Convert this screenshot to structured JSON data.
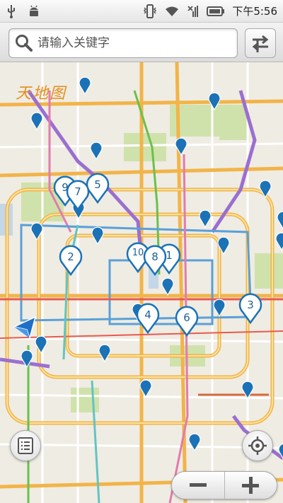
{
  "status_bar": {
    "time": "下午5:56",
    "icons": [
      "usb-icon",
      "android-debug-icon",
      "vibrate-icon",
      "wifi-icon",
      "no-signal-icon",
      "battery-icon"
    ]
  },
  "search": {
    "placeholder": "请输入关键字"
  },
  "map": {
    "logo_text": "天地图",
    "numbered_markers": [
      {
        "label": "9"
      },
      {
        "label": "7"
      },
      {
        "label": "5"
      },
      {
        "label": "2"
      },
      {
        "label": "10"
      },
      {
        "label": "8"
      },
      {
        "label": "1"
      },
      {
        "label": "4"
      },
      {
        "label": "6"
      },
      {
        "label": "3"
      }
    ],
    "colors": {
      "marker_blue": "#1b72b6",
      "ring_road": "#f2b449",
      "subway_purple": "#9b6fd0",
      "subway_green": "#6bbf4e",
      "subway_blue": "#5aa0d8",
      "park_green": "#cfe2ab"
    }
  },
  "controls": {
    "zoom_out": "−",
    "zoom_in": "+"
  }
}
